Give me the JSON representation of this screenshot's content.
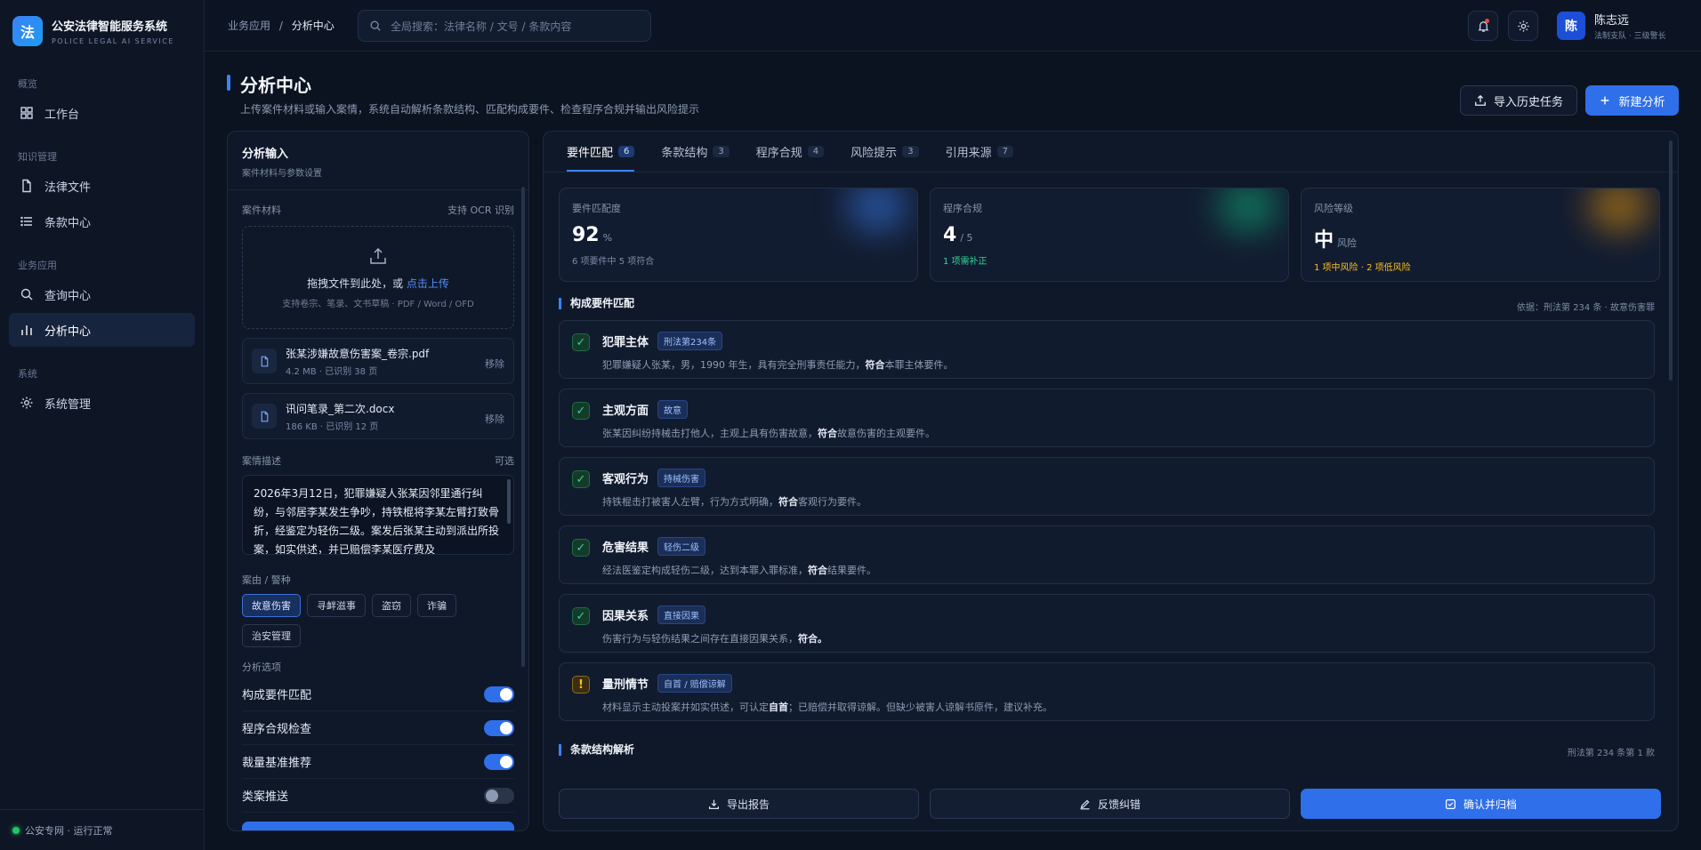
{
  "brand": {
    "logo_char": "法",
    "title": "公安法律智能服务系统",
    "subtitle": "POLICE LEGAL AI SERVICE"
  },
  "nav": {
    "groups": [
      {
        "label": "概览"
      },
      {
        "label": "知识管理"
      },
      {
        "label": "业务应用"
      },
      {
        "label": "系统"
      }
    ],
    "items": [
      {
        "label": "工作台",
        "icon": "grid-icon"
      },
      {
        "label": "法律文件",
        "icon": "file-icon"
      },
      {
        "label": "条款中心",
        "icon": "list-icon"
      },
      {
        "label": "查询中心",
        "icon": "search-icon"
      },
      {
        "label": "分析中心",
        "icon": "bar-chart-icon",
        "active": true
      },
      {
        "label": "系统管理",
        "icon": "gear-icon"
      }
    ],
    "footer": "公安专网 · 运行正常"
  },
  "topbar": {
    "breadcrumb_parent": "业务应用",
    "breadcrumb_sep": "/",
    "breadcrumb_current": "分析中心",
    "search_placeholder": "全局搜索：法律名称 / 文号 / 条款内容",
    "user_avatar": "陈",
    "user_name": "陈志远",
    "user_role": "法制支队 · 三级警长"
  },
  "page": {
    "title": "分析中心",
    "subtitle": "上传案件材料或输入案情，系统自动解析条款结构、匹配构成要件、检查程序合规并输出风险提示",
    "import_btn": "导入历史任务",
    "new_btn": "新建分析"
  },
  "input_panel": {
    "title": "分析输入",
    "subtitle": "案件材料与参数设置",
    "materials_label": "案件材料",
    "ocr_hint": "支持 OCR 识别",
    "upload_main": "拖拽文件到此处，或",
    "upload_link": "点击上传",
    "upload_hint": "支持卷宗、笔录、文书草稿 · PDF / Word / OFD",
    "files": [
      {
        "name": "张某涉嫌故意伤害案_卷宗.pdf",
        "meta": "4.2 MB · 已识别 38 页",
        "remove": "移除"
      },
      {
        "name": "讯问笔录_第二次.docx",
        "meta": "186 KB · 已识别 12 页",
        "remove": "移除"
      }
    ],
    "desc_label": "案情描述",
    "desc_optional": "可选",
    "desc_text": "2026年3月12日，犯罪嫌疑人张某因邻里通行纠纷，与邻居李某发生争吵，持铁棍将李某左臂打致骨折，经鉴定为轻伤二级。案发后张某主动到派出所投案，如实供述，并已赔偿李某医疗费及",
    "category_label": "案由 / 警种",
    "categories": [
      {
        "label": "故意伤害",
        "on": true
      },
      {
        "label": "寻衅滋事",
        "on": false
      },
      {
        "label": "盗窃",
        "on": false
      },
      {
        "label": "诈骗",
        "on": false
      },
      {
        "label": "治安管理",
        "on": false
      }
    ],
    "options_label": "分析选项",
    "options": [
      {
        "label": "构成要件匹配",
        "on": true
      },
      {
        "label": "程序合规检查",
        "on": true
      },
      {
        "label": "裁量基准推荐",
        "on": true
      },
      {
        "label": "类案推送",
        "on": false
      }
    ]
  },
  "result_panel": {
    "tabs": [
      {
        "label": "要件匹配",
        "count": "6",
        "active": true
      },
      {
        "label": "条款结构",
        "count": "3"
      },
      {
        "label": "程序合规",
        "count": "4"
      },
      {
        "label": "风险提示",
        "count": "3"
      },
      {
        "label": "引用来源",
        "count": "7"
      }
    ],
    "stats": [
      {
        "label": "要件匹配度",
        "value": "92",
        "unit": "%",
        "note": "6 项要件中 5 项符合",
        "note_color": "#7b8aa5",
        "glow": "#3b82f6"
      },
      {
        "label": "程序合规",
        "value": "4",
        "unit": "/ 5",
        "note": "1 项需补正",
        "note_color": "#34d399",
        "glow": "#10b981"
      },
      {
        "label": "风险等级",
        "value": "中",
        "unit": "风险",
        "note": "1 项中风险 · 2 项低风险",
        "note_color": "#fbbf24",
        "glow": "#f59e0b"
      }
    ],
    "section1_title": "构成要件匹配",
    "section1_right": "依据：刑法第 234 条 · 故意伤害罪",
    "requirements": [
      {
        "name": "犯罪主体",
        "tag": "刑法第234条",
        "status": "ok",
        "mark": "✓",
        "desc_pre": "犯罪嫌疑人张某，男，1990 年生，具有完全刑事责任能力，",
        "desc_bold": "符合",
        "desc_post": "本罪主体要件。"
      },
      {
        "name": "主观方面",
        "tag": "故意",
        "status": "ok",
        "mark": "✓",
        "desc_pre": "张某因纠纷持械击打他人，主观上具有伤害故意，",
        "desc_bold": "符合",
        "desc_post": "故意伤害的主观要件。"
      },
      {
        "name": "客观行为",
        "tag": "持械伤害",
        "status": "ok",
        "mark": "✓",
        "desc_pre": "持铁棍击打被害人左臂，行为方式明确，",
        "desc_bold": "符合",
        "desc_post": "客观行为要件。"
      },
      {
        "name": "危害结果",
        "tag": "轻伤二级",
        "status": "ok",
        "mark": "✓",
        "desc_pre": "经法医鉴定构成轻伤二级，达到本罪入罪标准，",
        "desc_bold": "符合",
        "desc_post": "结果要件。"
      },
      {
        "name": "因果关系",
        "tag": "直接因果",
        "status": "ok",
        "mark": "✓",
        "desc_pre": "伤害行为与轻伤结果之间存在直接因果关系，",
        "desc_bold": "符合。",
        "desc_post": ""
      },
      {
        "name": "量刑情节",
        "tag": "自首 / 赔偿谅解",
        "status": "warn",
        "mark": "!",
        "desc_pre": "材料显示主动投案并如实供述，可认定",
        "desc_bold": "自首",
        "desc_post": "；已赔偿并取得谅解。但缺少被害人谅解书原件，建议补充。"
      }
    ],
    "section2_title": "条款结构解析",
    "section2_right": "刑法第 234 条第 1 款",
    "actions": {
      "export": "导出报告",
      "feedback": "反馈纠错",
      "confirm": "确认并归档"
    }
  }
}
